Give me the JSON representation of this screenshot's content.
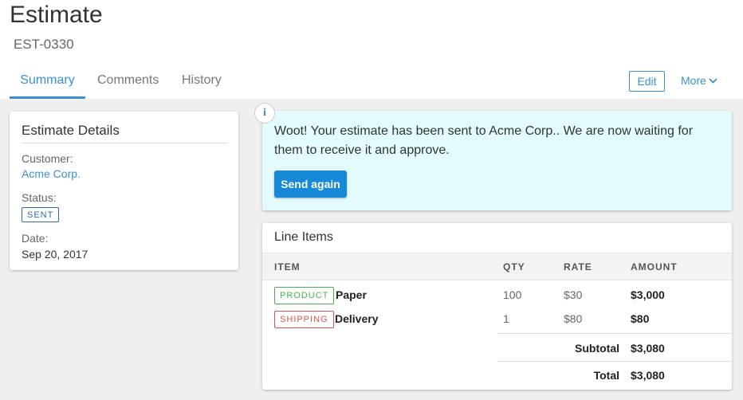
{
  "header": {
    "title": "Estimate",
    "number": "EST-0330",
    "tabs": [
      {
        "label": "Summary",
        "active": true
      },
      {
        "label": "Comments",
        "active": false
      },
      {
        "label": "History",
        "active": false
      }
    ],
    "edit_label": "Edit",
    "more_label": "More"
  },
  "details": {
    "title": "Estimate Details",
    "customer_label": "Customer:",
    "customer_value": "Acme Corp.",
    "status_label": "Status:",
    "status_value": "SENT",
    "date_label": "Date:",
    "date_value": "Sep 20, 2017"
  },
  "notice": {
    "icon": "i",
    "message": "Woot! Your estimate has been sent to Acme Corp.. We are now waiting for them to receive it and approve.",
    "button_label": "Send again"
  },
  "line_items": {
    "title": "Line Items",
    "columns": [
      "ITEM",
      "QTY",
      "RATE",
      "AMOUNT"
    ],
    "rows": [
      {
        "tag": "PRODUCT",
        "name": "Paper",
        "qty": "100",
        "rate": "$30",
        "amount": "$3,000"
      },
      {
        "tag": "SHIPPING",
        "name": "Delivery",
        "qty": "1",
        "rate": "$80",
        "amount": "$80"
      }
    ],
    "subtotal_label": "Subtotal",
    "subtotal_value": "$3,080",
    "total_label": "Total",
    "total_value": "$3,080"
  },
  "colors": {
    "accent": "#3b8fd8",
    "notice_bg": "#e3fbfc",
    "product_tag": "#4cae4c",
    "shipping_tag": "#d9534f"
  }
}
